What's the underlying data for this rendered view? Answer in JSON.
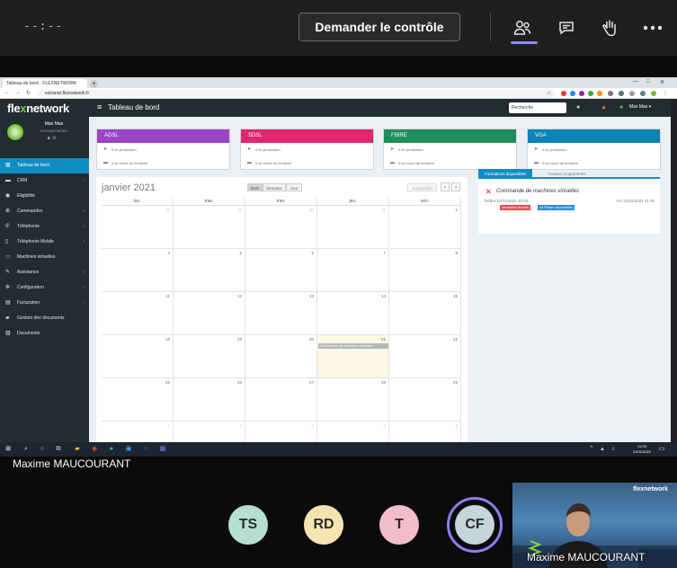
{
  "teams": {
    "timer": "--:--",
    "request_control": "Demander le contrôle",
    "shared_by": "Maxime MAUCOURANT"
  },
  "browser": {
    "tab_title": "Tableau de bord · FLEXNETWORK",
    "url": "extranet.flexnetwork.fr"
  },
  "app": {
    "logo_a": "fle",
    "logo_x": "x",
    "logo_b": "network",
    "page_title": "Tableau de bord",
    "search_placeholder": "Recherche",
    "user_short": "Max Max ▾",
    "user_name": "Max Max",
    "user_sub": "FLEXNETWORK",
    "menu": [
      {
        "label": "Tableau de bord",
        "icon": "dashboard-icon",
        "glyph": "▦",
        "chevron": ""
      },
      {
        "label": "CRM",
        "icon": "crm-icon",
        "glyph": "▬",
        "chevron": "‹"
      },
      {
        "label": "Eligibilité",
        "icon": "eligibility-icon",
        "glyph": "◉",
        "chevron": ""
      },
      {
        "label": "Commandes",
        "icon": "cart-icon",
        "glyph": "⊕",
        "chevron": "‹"
      },
      {
        "label": "Téléphonie",
        "icon": "phone-icon",
        "glyph": "✆",
        "chevron": "‹"
      },
      {
        "label": "Téléphonie Mobile",
        "icon": "mobile-icon",
        "glyph": "▯",
        "chevron": "‹"
      },
      {
        "label": "Machines virtuelles",
        "icon": "vm-icon",
        "glyph": "▭",
        "chevron": ""
      },
      {
        "label": "Assistance",
        "icon": "wrench-icon",
        "glyph": "✎",
        "chevron": "‹"
      },
      {
        "label": "Configuration",
        "icon": "gear-icon",
        "glyph": "✲",
        "chevron": "‹"
      },
      {
        "label": "Facturation",
        "icon": "invoice-icon",
        "glyph": "▤",
        "chevron": "‹"
      },
      {
        "label": "Gestion des documents",
        "icon": "folder-icon",
        "glyph": "▰",
        "chevron": ""
      },
      {
        "label": "Documents",
        "icon": "document-icon",
        "glyph": "▥",
        "chevron": ""
      }
    ],
    "cards": [
      {
        "title": "ADSL",
        "color": "#9b45c6",
        "line1": "0 en production",
        "line2": "0 en cours de livraison"
      },
      {
        "title": "SDSL",
        "color": "#e0266f",
        "line1": "0 en production",
        "line2": "0 en cours de livraison"
      },
      {
        "title": "FIBRE",
        "color": "#1f8e5e",
        "line1": "0 en production",
        "line2": "0 en cours de livraison"
      },
      {
        "title": "VGA",
        "color": "#0e83b5",
        "line1": "0 en production",
        "line2": "0 en cours de livraison"
      }
    ],
    "calendar": {
      "title": "janvier 2021",
      "view_month": "Mois",
      "view_week": "Semaine",
      "view_day": "Jour",
      "today": "Aujourd'hui",
      "prev": "‹",
      "next": "›",
      "days": [
        "lun.",
        "mar.",
        "mer.",
        "jeu.",
        "ven."
      ],
      "weeks": [
        [
          "28",
          "29",
          "30",
          "31",
          "1"
        ],
        [
          "4",
          "5",
          "6",
          "7",
          "8"
        ],
        [
          "11",
          "12",
          "13",
          "14",
          "15"
        ],
        [
          "18",
          "19",
          "20",
          "21",
          "22"
        ],
        [
          "25",
          "26",
          "27",
          "28",
          "29"
        ],
        [
          "1",
          "2",
          "3",
          "4",
          "5"
        ]
      ],
      "event_label": "Commande de machines virtuelles"
    },
    "panel": {
      "tab_active": "Formations disponibles",
      "tab_other": "Travaux programmés",
      "title": "Commande de machines virtuelles",
      "start": "Début 21/01/2021 10:00",
      "end": "Fin 21/01/2021 11:00",
      "badge1": "Inscription fermée",
      "badge2": "25 Places disponibles"
    },
    "taskbar_time": "11:25",
    "taskbar_date": "21/01/2021"
  },
  "participants": [
    {
      "initials": "TS",
      "color": "#b5e0cf"
    },
    {
      "initials": "RD",
      "color": "#f6e4b0"
    },
    {
      "initials": "T",
      "color": "#f2bcc8"
    },
    {
      "initials": "CF",
      "color": "#c6d4dc"
    }
  ],
  "video": {
    "name": "Maxime MAUCOURANT",
    "brand": "flexnetwork"
  }
}
